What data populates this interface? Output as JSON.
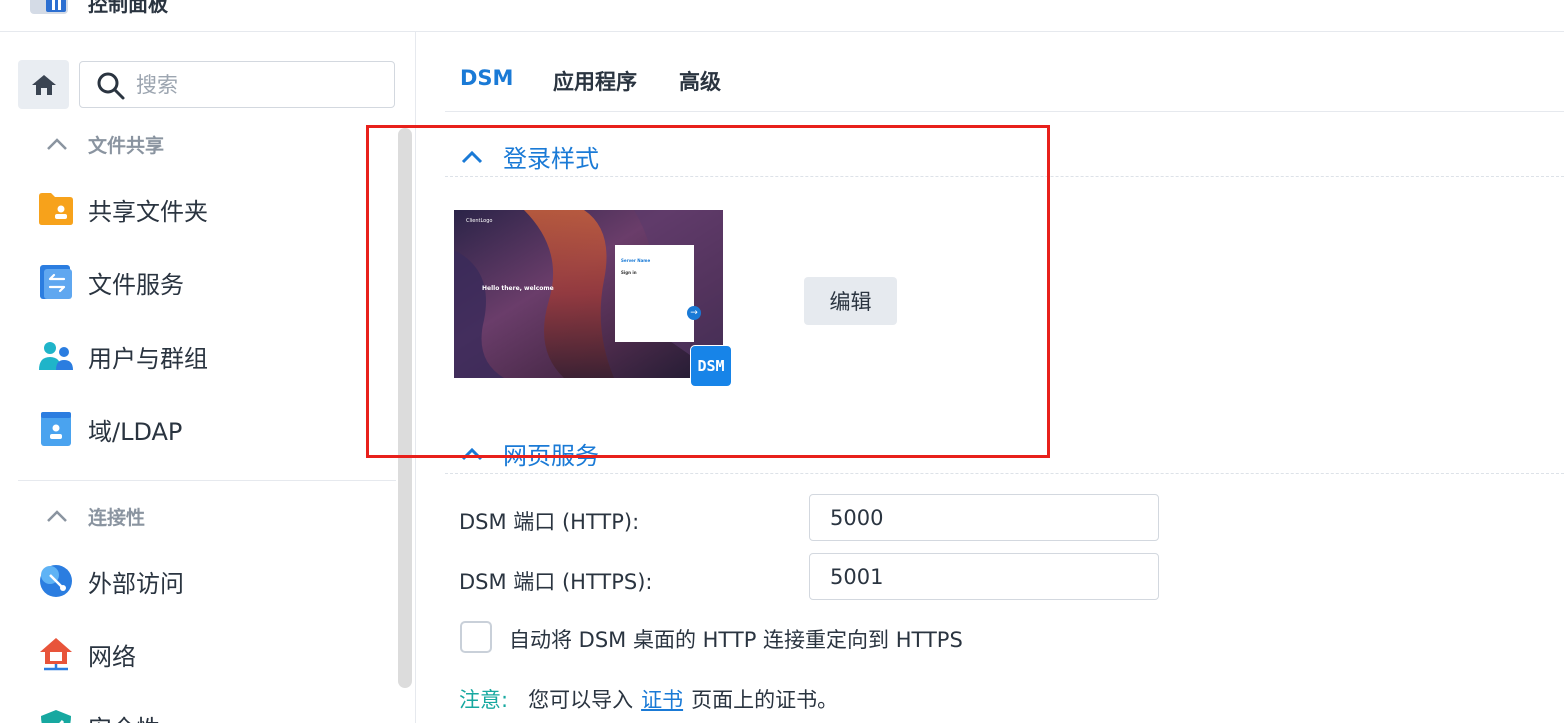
{
  "window": {
    "title": "控制面板"
  },
  "sidebar": {
    "search_placeholder": "搜索",
    "groups": [
      {
        "label": "文件共享",
        "items": [
          {
            "label": "共享文件夹",
            "icon": "shared-folder-icon"
          },
          {
            "label": "文件服务",
            "icon": "file-services-icon"
          },
          {
            "label": "用户与群组",
            "icon": "users-groups-icon"
          },
          {
            "label": "域/LDAP",
            "icon": "domain-ldap-icon"
          }
        ]
      },
      {
        "label": "连接性",
        "items": [
          {
            "label": "外部访问",
            "icon": "external-access-icon"
          },
          {
            "label": "网络",
            "icon": "network-icon"
          },
          {
            "label": "安全性",
            "icon": "security-icon"
          }
        ]
      }
    ]
  },
  "tabs": [
    {
      "label": "DSM",
      "active": true
    },
    {
      "label": "应用程序",
      "active": false
    },
    {
      "label": "高级",
      "active": false
    }
  ],
  "login_style": {
    "title": "登录样式",
    "edit_label": "编辑",
    "badge": "DSM",
    "preview": {
      "logo": "ClientLogo",
      "welcome": "Hello there, welcome",
      "server_name": "Server Name",
      "sign_in": "Sign in"
    }
  },
  "web_services": {
    "title": "网页服务",
    "http_label": "DSM 端口 (HTTP):",
    "http_value": "5000",
    "https_label": "DSM 端口 (HTTPS):",
    "https_value": "5001",
    "redirect_label": "自动将 DSM 桌面的 HTTP 连接重定向到 HTTPS",
    "note_key": "注意:",
    "note_prefix": "您可以导入",
    "note_link": "证书",
    "note_suffix": "页面上的证书。"
  },
  "colors": {
    "accent": "#1a7ad6",
    "highlight": "#e8201b",
    "note": "#17a8a0"
  }
}
